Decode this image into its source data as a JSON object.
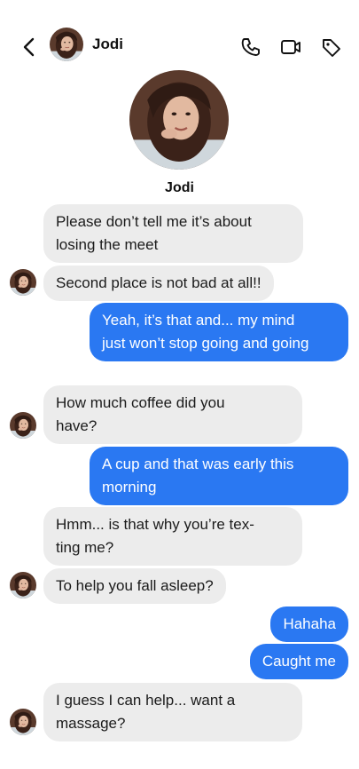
{
  "header": {
    "contact_name": "Jodi",
    "icons": [
      "back-chevron-icon",
      "phone-icon",
      "video-camera-icon",
      "tag-icon"
    ]
  },
  "profile": {
    "name": "Jodi"
  },
  "messages": [
    {
      "from": "them",
      "text": "Please don’t tell me it’s about losing the meet",
      "lines": [
        "Please don’t tell me it’s about",
        "losing the meet"
      ]
    },
    {
      "from": "them",
      "text": "Second place is not bad at all!!"
    },
    {
      "from": "me",
      "lines": [
        "Yeah, it’s that and... my mind",
        "just won’t stop going and going"
      ]
    },
    {
      "from": "them",
      "lines": [
        "How much coffee did you",
        "have?"
      ]
    },
    {
      "from": "me",
      "lines": [
        "A cup and that was early this",
        "morning"
      ]
    },
    {
      "from": "them",
      "lines": [
        "Hmm... is that why you’re tex-",
        "ting me?"
      ]
    },
    {
      "from": "them",
      "text": "To help you fall asleep?"
    },
    {
      "from": "me",
      "text": "Hahaha"
    },
    {
      "from": "me",
      "text": "Caught me"
    },
    {
      "from": "them",
      "lines": [
        "I guess I can help... want a",
        "massage?"
      ]
    }
  ],
  "colors": {
    "outgoing": "#2a78f2",
    "incoming": "#ececec"
  }
}
